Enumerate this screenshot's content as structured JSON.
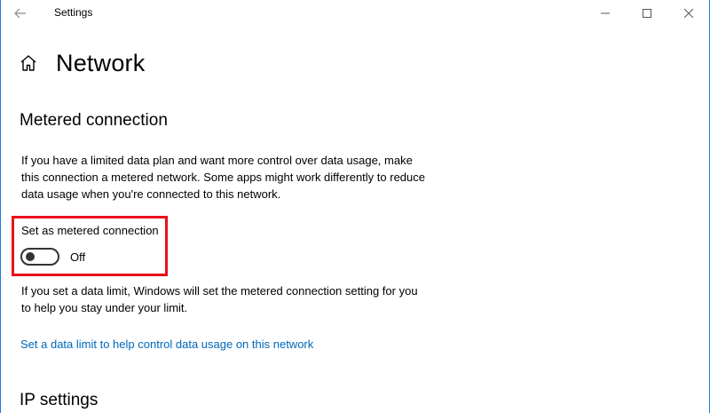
{
  "window": {
    "title": "Settings",
    "accent_color": "#1f7ad8"
  },
  "header": {
    "icon": "home-icon",
    "title": "Network"
  },
  "metered": {
    "section_title": "Metered connection",
    "description": "If you have a limited data plan and want more control over data usage, make this connection a metered network. Some apps might work differently to reduce data usage when you're connected to this network.",
    "toggle_label": "Set as metered connection",
    "toggle_state": "Off",
    "toggle_on": false,
    "highlight_color": "#e8101b",
    "limit_note": "If you set a data limit, Windows will set the metered connection setting for you to help you stay under your limit.",
    "limit_link": "Set a data limit to help control data usage on this network",
    "link_color": "#0067b8"
  },
  "ip_settings": {
    "section_title": "IP settings"
  }
}
